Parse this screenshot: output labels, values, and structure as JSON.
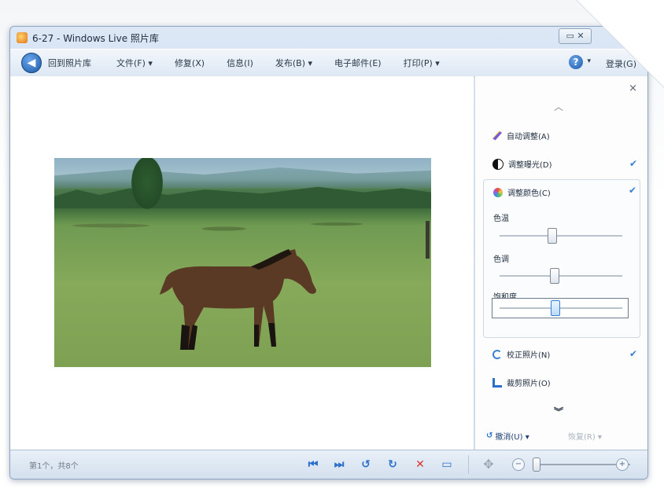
{
  "window": {
    "title": "6-27 - Windows Live 照片库",
    "controls": "▭ ✕"
  },
  "menubar": {
    "back_label": "回到照片库",
    "items": [
      "文件(F) ▾",
      "修复(X)",
      "信息(I)",
      "发布(B) ▾",
      "电子邮件(E)",
      "打印(P) ▾"
    ],
    "help": "?",
    "help_caret": "▾",
    "signin": "登录(G)"
  },
  "sidebar": {
    "close": "×",
    "up": "︿",
    "auto_adjust": "自动调整(A)",
    "adjust_exposure": "调整曝光(D)",
    "adjust_color": "调整颜色(C)",
    "color_temp": "色温",
    "tint": "色调",
    "saturation": "饱和度",
    "straighten": "校正照片(N)",
    "crop": "裁剪照片(O)",
    "check": "✔",
    "down": "︾",
    "undo": "撤消(U) ▾",
    "redo": "恢复(R) ▾",
    "slider_levels": {
      "color_temp": 0.42,
      "tint": 0.44,
      "saturation": 0.45
    }
  },
  "status": {
    "text": "第1个，共8个",
    "icons": [
      "previous-icon",
      "next-icon",
      "rotate-left-icon",
      "rotate-right-icon",
      "delete-icon",
      "slideshow-icon",
      "fit-icon"
    ],
    "zoom_level": 0.0
  },
  "colors": {
    "accent_blue": "#2a6fc9",
    "delete_red": "#d9362f"
  }
}
